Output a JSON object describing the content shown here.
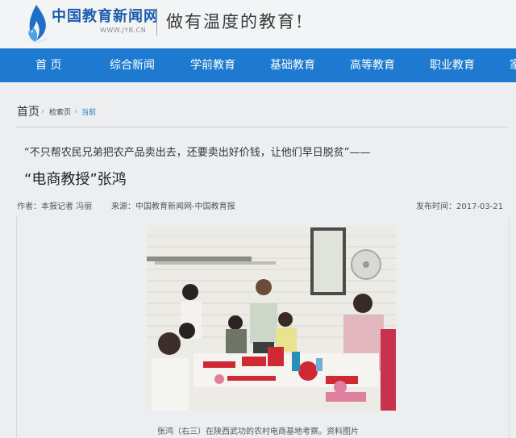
{
  "header": {
    "site_name": "中国教育新闻网",
    "site_url": "WWW.JYB.CN",
    "slogan": "做有温度的教育!"
  },
  "nav": {
    "items": [
      "首 页",
      "综合新闻",
      "学前教育",
      "基础教育",
      "高等教育",
      "职业教育",
      "家"
    ]
  },
  "breadcrumb": {
    "home": "首页",
    "search": "检索页",
    "current": "当前"
  },
  "article": {
    "quote": "“不只帮农民兄弟把农产品卖出去，还要卖出好价钱，让他们早日脱贫”——",
    "title": "“电商教授”张鸿",
    "author": "作者：本报记者 冯丽",
    "source": "来源：中国教育新闻网-中国教育报",
    "publish_time": "发布时间：2017-03-21",
    "caption": "张鸿（右三）在陕西武功的农村电商基地考察。资料图片"
  },
  "colors": {
    "brand_blue": "#1a5cae",
    "nav_blue": "#1e7ad0",
    "breadcrumb_current": "#1e7ad0"
  }
}
